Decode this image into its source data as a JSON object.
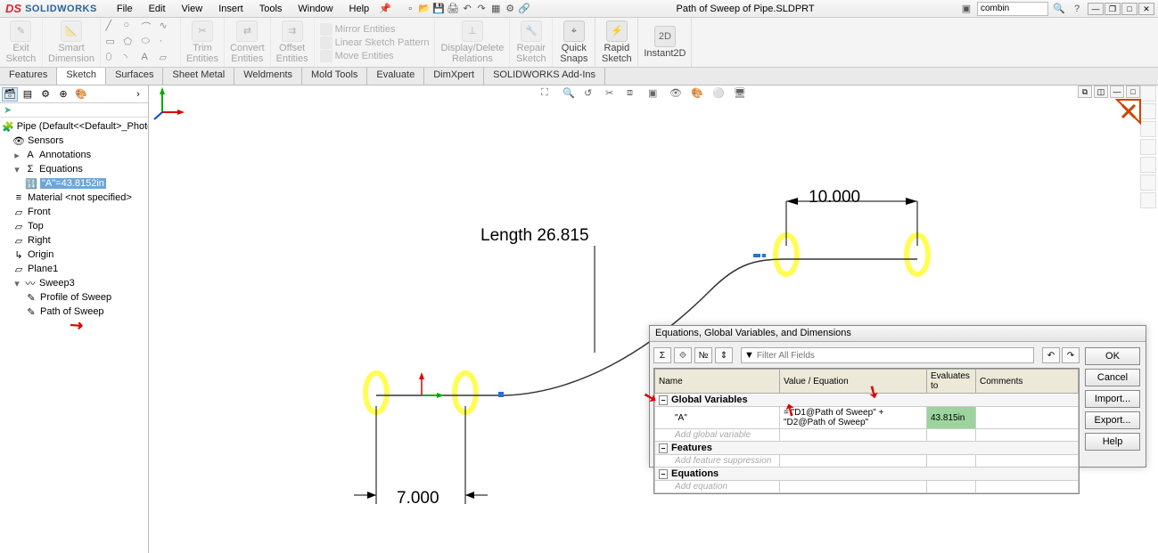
{
  "app": {
    "brand_prefix": "DS",
    "brand": "SOLIDWORKS",
    "document_title": "Path of Sweep of Pipe.SLDPRT",
    "search_value": "combin"
  },
  "menu": {
    "items": [
      "File",
      "Edit",
      "View",
      "Insert",
      "Tools",
      "Window",
      "Help"
    ]
  },
  "ribbon": {
    "exit_sketch": "Exit\nSketch",
    "smart_dim": "Smart\nDimension",
    "trim": "Trim\nEntities",
    "convert": "Convert\nEntities",
    "offset": "Offset\nEntities",
    "mirror": "Mirror Entities",
    "pattern": "Linear Sketch Pattern",
    "move": "Move Entities",
    "display_delete": "Display/Delete\nRelations",
    "repair": "Repair\nSketch",
    "quick_snaps": "Quick\nSnaps",
    "rapid": "Rapid\nSketch",
    "instant2d": "Instant2D"
  },
  "tabs": {
    "items": [
      "Features",
      "Sketch",
      "Surfaces",
      "Sheet Metal",
      "Weldments",
      "Mold Tools",
      "Evaluate",
      "DimXpert",
      "SOLIDWORKS Add-Ins"
    ],
    "active_index": 1
  },
  "tree": {
    "root": "Pipe  (Default<<Default>_PhotoWorks Di",
    "sensors": "Sensors",
    "annotations": "Annotations",
    "equations": "Equations",
    "eq_a": "\"A\"=43.8152in",
    "material": "Material <not specified>",
    "front": "Front",
    "top": "Top",
    "right": "Right",
    "origin": "Origin",
    "plane1": "Plane1",
    "sweep3": "Sweep3",
    "profile": "Profile of Sweep",
    "path": "Path of Sweep"
  },
  "canvas": {
    "dim_length_label": "Length 26.815",
    "dim_7": "7.000",
    "dim_10": "10.000"
  },
  "dialog": {
    "title": "Equations, Global Variables, and Dimensions",
    "filter_placeholder": "Filter All Fields",
    "cols": {
      "name": "Name",
      "value": "Value / Equation",
      "evaluates": "Evaluates to",
      "comments": "Comments"
    },
    "sections": {
      "globals": "Global Variables",
      "features": "Features",
      "equations": "Equations"
    },
    "row_a": {
      "name": "\"A\"",
      "value": "= \"D1@Path of Sweep\"  +  \"D2@Path of Sweep\"",
      "eval": "43.815in"
    },
    "placeholders": {
      "add_global": "Add global variable",
      "add_feature": "Add feature suppression",
      "add_eq": "Add equation"
    },
    "buttons": {
      "ok": "OK",
      "cancel": "Cancel",
      "import": "Import...",
      "export": "Export...",
      "help": "Help"
    }
  }
}
